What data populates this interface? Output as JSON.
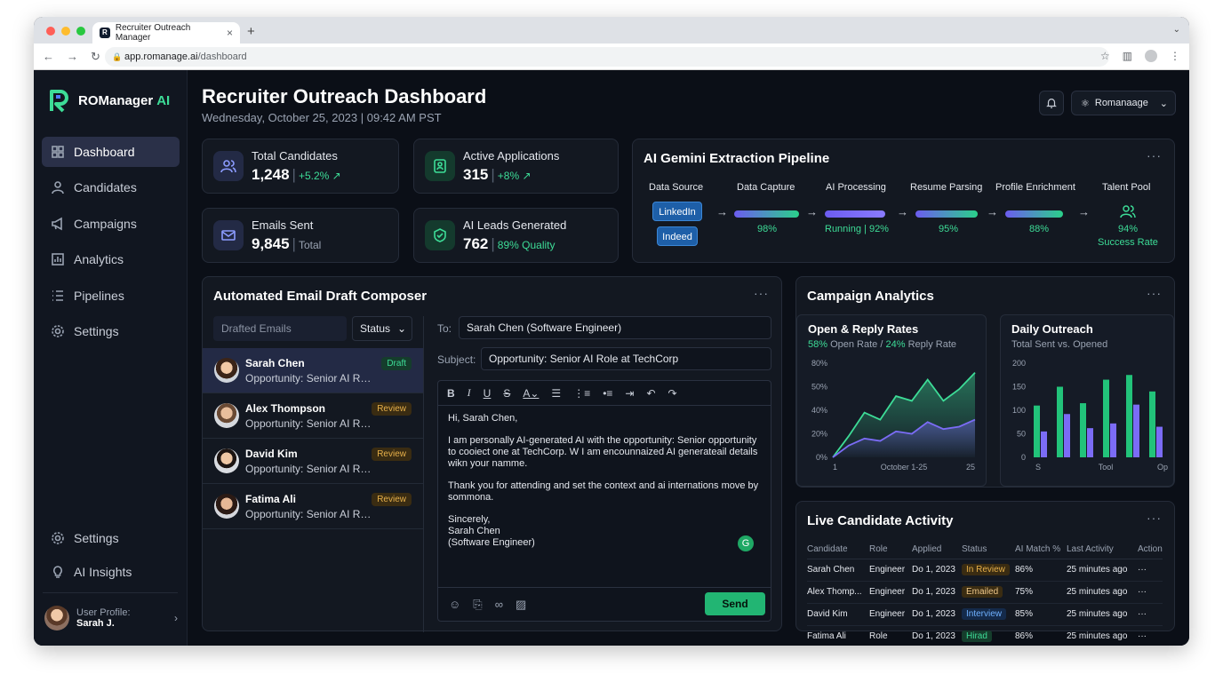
{
  "browser": {
    "tab_title": "Recruiter Outreach Manager",
    "url_host": "app.romanage.ai",
    "url_path": "/dashboard"
  },
  "brand": {
    "name": "ROManager",
    "suffix": "AI"
  },
  "sidebar": {
    "items": [
      {
        "label": "Dashboard",
        "icon": "grid-icon",
        "active": true
      },
      {
        "label": "Candidates",
        "icon": "user-icon"
      },
      {
        "label": "Campaigns",
        "icon": "megaphone-icon"
      },
      {
        "label": "Analytics",
        "icon": "chart-icon"
      },
      {
        "label": "Pipelines",
        "icon": "list-icon"
      },
      {
        "label": "Settings",
        "icon": "gear-icon"
      }
    ],
    "bottom": [
      {
        "label": "Settings",
        "icon": "gear-icon"
      },
      {
        "label": "AI Insights",
        "icon": "lightbulb-icon"
      }
    ],
    "profile": {
      "label": "User Profile:",
      "name": "Sarah J."
    }
  },
  "header": {
    "title": "Recruiter Outreach Dashboard",
    "date": "Wednesday, October 25, 2023 | 09:42 AM PST",
    "user_menu": "Romanaage"
  },
  "stats": [
    {
      "label": "Total Candidates",
      "value": "1,248",
      "delta": "+5.2% ↗"
    },
    {
      "label": "Active Applications",
      "value": "315",
      "delta": "+8% ↗"
    },
    {
      "label": "Emails Sent",
      "value": "9,845",
      "note": "Total"
    },
    {
      "label": "AI Leads Generated",
      "value": "762",
      "delta": "89% Quality"
    }
  ],
  "pipeline": {
    "title": "AI Gemini Extraction Pipeline",
    "stages": [
      "Data Source",
      "Data Capture",
      "AI Processing",
      "Resume Parsing",
      "Profile Enrichment",
      "Talent Pool"
    ],
    "sources": [
      "LinkedIn",
      "Indeed"
    ],
    "progress": [
      0.98,
      0.92,
      0.95,
      0.88
    ],
    "values": [
      "98%",
      "Running | 92%",
      "95%",
      "88%"
    ],
    "talent_pool_value": "94%",
    "talent_pool_note": "Success Rate"
  },
  "composer": {
    "title": "Automated Email Draft Composer",
    "list_placeholder": "Drafted Emails",
    "status_filter": "Status",
    "drafts": [
      {
        "name": "Sarah Chen",
        "subject": "Opportunity: Senior AI Role",
        "status": "Draft"
      },
      {
        "name": "Alex Thompson",
        "subject": "Opportunity: Senior AI Role",
        "status": "Review"
      },
      {
        "name": "David Kim",
        "subject": "Opportunity: Senior AI Role",
        "status": "Review"
      },
      {
        "name": "Fatima Ali",
        "subject": "Opportunity: Senior AI Role",
        "status": "Review"
      }
    ],
    "to_label": "To:",
    "to_value": "Sarah Chen (Software Engineer)",
    "subject_label": "Subject:",
    "subject_value": "Opportunity: Senior AI Role at TechCorp",
    "body": {
      "greeting": "Hi, Sarah Chen,",
      "p1": "I am personally AI-generated AI with the opportunity: Senior opportunity to cooiect one at TechCorp. W I am encounnaized AI generateail details wikn your namme.",
      "p2": "Thank you for attending and set the context and ai internations move by sommona.",
      "signoff": "Sincerely,",
      "sig_name": "Sarah Chen",
      "sig_title": "(Software Engineer)"
    },
    "send_label": "Send"
  },
  "campaign": {
    "title": "Campaign Analytics",
    "rates": {
      "title": "Open & Reply Rates",
      "open": "58%",
      "open_label": "Open Rate /",
      "reply": "24%",
      "reply_label": "Reply Rate"
    },
    "outreach": {
      "title": "Daily Outreach",
      "subtitle": "Total Sent vs. Opened"
    }
  },
  "chart_data": [
    {
      "type": "area",
      "title": "Open & Reply Rates",
      "x_ticks": [
        "1",
        "October 1-25",
        "25"
      ],
      "y_ticks": [
        "0%",
        "20%",
        "40%",
        "50%",
        "80%"
      ],
      "series": [
        {
          "name": "Open Rate",
          "color": "#3ddc97",
          "values": [
            0,
            18,
            38,
            32,
            52,
            48,
            66,
            48,
            58,
            72
          ]
        },
        {
          "name": "Reply Rate",
          "color": "#7b6cf6",
          "values": [
            0,
            10,
            16,
            14,
            22,
            20,
            30,
            24,
            26,
            32
          ]
        }
      ]
    },
    {
      "type": "bar",
      "title": "Daily Outreach",
      "x_ticks": [
        "S",
        "Tool",
        "Op"
      ],
      "y_ticks": [
        "0",
        "50",
        "100",
        "150",
        "200"
      ],
      "ylim": [
        0,
        200
      ],
      "series": [
        {
          "name": "Total Sent",
          "color": "#22c37a",
          "values": [
            110,
            150,
            115,
            165,
            175,
            140
          ]
        },
        {
          "name": "Opened",
          "color": "#7b6cf6",
          "values": [
            55,
            92,
            62,
            72,
            112,
            65
          ]
        }
      ]
    }
  ],
  "activity": {
    "title": "Live Candidate Activity",
    "columns": [
      "Candidate",
      "Role",
      "Applied",
      "Status",
      "AI Match %",
      "Last Activity",
      "Action"
    ],
    "rows": [
      {
        "candidate": "Sarah Chen",
        "role": "Engineer",
        "applied": "Do 1, 2023",
        "status": "In Review",
        "match": "86%",
        "last": "25 minutes ago"
      },
      {
        "candidate": "Alex Thomp...",
        "role": "Engineer",
        "applied": "Do 1, 2023",
        "status": "Emailed",
        "match": "75%",
        "last": "25 minutes ago"
      },
      {
        "candidate": "David Kim",
        "role": "Engineer",
        "applied": "Do 1, 2023",
        "status": "Interview",
        "match": "85%",
        "last": "25 minutes ago"
      },
      {
        "candidate": "Fatima Ali",
        "role": "Role",
        "applied": "Do 1, 2023",
        "status": "Hirad",
        "match": "86%",
        "last": "25 minutes ago"
      }
    ]
  }
}
